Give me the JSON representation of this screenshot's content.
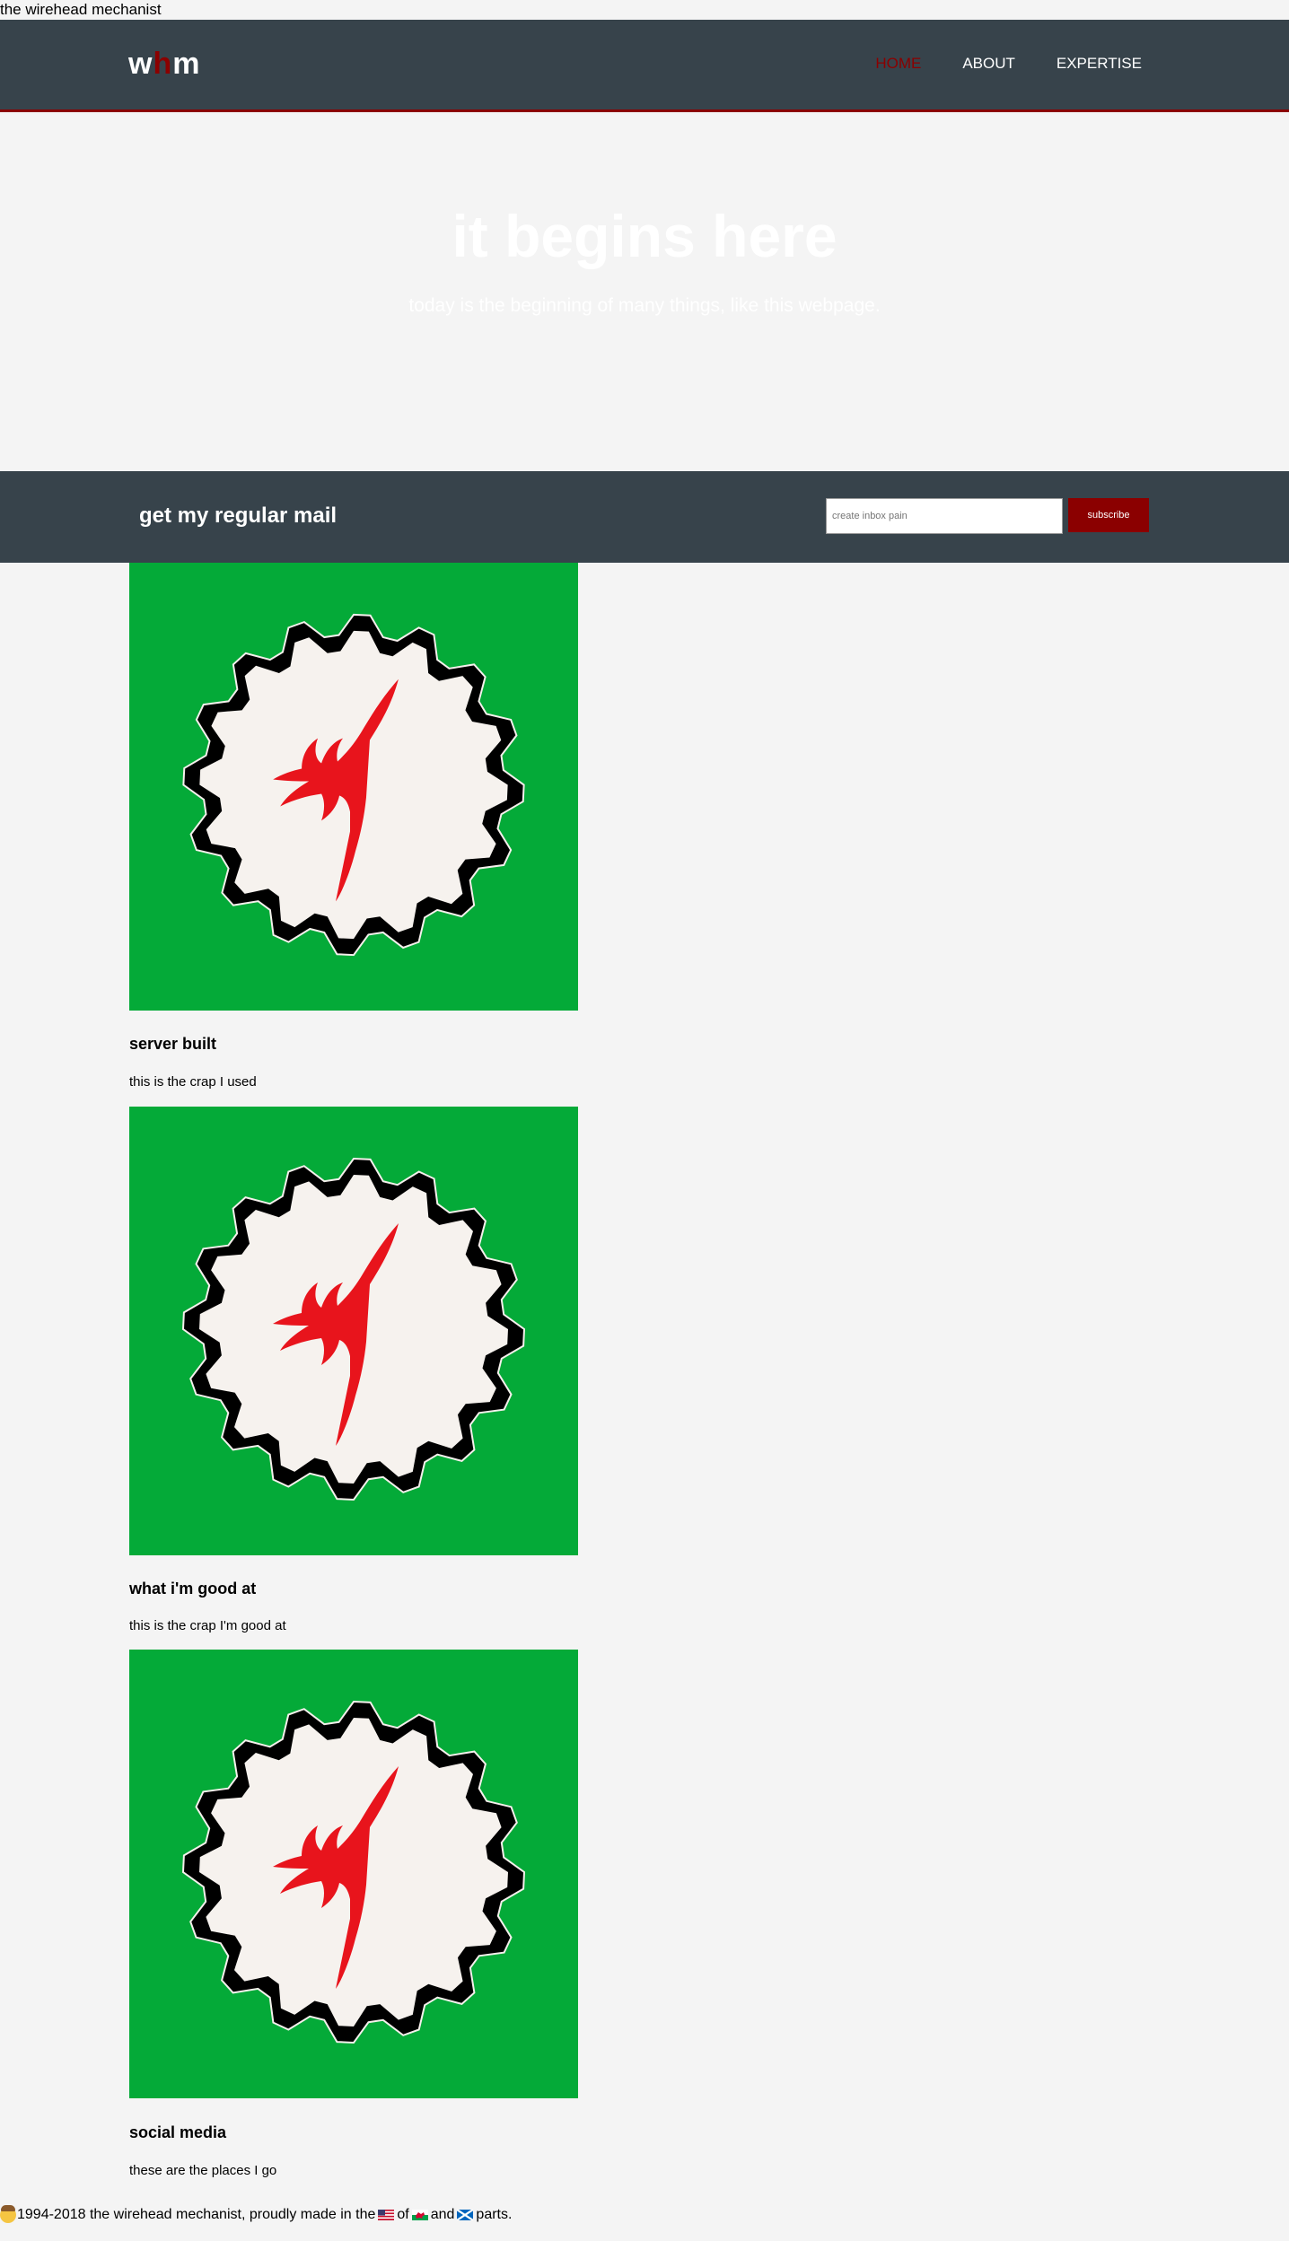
{
  "page": {
    "title": "the wirehead mechanist"
  },
  "header": {
    "logo": {
      "left": "w",
      "middle": "h",
      "right": "m"
    },
    "nav": [
      {
        "label": "HOME",
        "active": true
      },
      {
        "label": "ABOUT",
        "active": false
      },
      {
        "label": "EXPERTISE",
        "active": false
      }
    ]
  },
  "hero": {
    "title": "it begins here",
    "subtitle": "today is the beginning of many things, like this webpage."
  },
  "subscribe": {
    "title": "get my regular mail",
    "input_placeholder": "create inbox pain",
    "button_label": "subscribe"
  },
  "cards": [
    {
      "title": "server built",
      "description": "this is the crap I used",
      "image_icon": "red-dragon-gear-logo"
    },
    {
      "title": "what i'm good at",
      "description": "this is the crap I'm good at",
      "image_icon": "red-dragon-gear-logo"
    },
    {
      "title": "social media",
      "description": "these are the places I go",
      "image_icon": "red-dragon-gear-logo"
    }
  ],
  "footer": {
    "emoji_icon": "cowboy-face-icon",
    "text_start": "1994-2018 the wirehead mechanist, proudly made in the",
    "text_of": "of",
    "text_and": "and",
    "text_end": "parts.",
    "flag_icons": [
      "us-flag-icon",
      "wales-flag-icon",
      "scotland-flag-icon"
    ]
  },
  "colors": {
    "navbar": "#37434b",
    "accent": "#8b0000",
    "card_bg": "#04aa38",
    "dragon": "#e8141c",
    "page_bg": "#f4f4f4"
  }
}
